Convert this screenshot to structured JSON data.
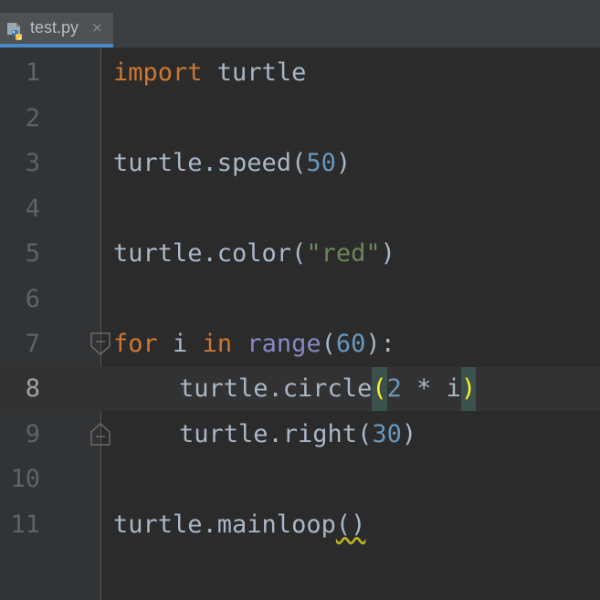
{
  "tab": {
    "filename": "test.py",
    "close_glyph": "×",
    "icon": "python-file-icon"
  },
  "gutter": {
    "line_numbers": [
      "1",
      "2",
      "3",
      "4",
      "5",
      "6",
      "7",
      "8",
      "9",
      "10",
      "11"
    ],
    "current_line": "8"
  },
  "code": {
    "line1": {
      "keyword": "import",
      "module": " turtle"
    },
    "line3": {
      "call": "turtle.speed(",
      "arg": "50",
      "close": ")"
    },
    "line5": {
      "call": "turtle.color(",
      "arg": "\"red\"",
      "close": ")"
    },
    "line7": {
      "kw_for": "for",
      "var": " i ",
      "kw_in": "in",
      "sp": " ",
      "builtin": "range",
      "open": "(",
      "arg": "60",
      "close": "):"
    },
    "line8": {
      "call": "turtle.circle",
      "open": "(",
      "num": "2",
      "rest": " * i",
      "close": ")"
    },
    "line9": {
      "call": "turtle.right(",
      "arg": "30",
      "close": ")"
    },
    "line11": {
      "call": "turtle.mainloop",
      "parens": "()"
    }
  },
  "colors": {
    "background": "#2b2b2b",
    "keyword": "#cc7832",
    "number": "#6897bb",
    "string": "#6a8759",
    "builtin": "#8888c6",
    "text": "#a9b7c6",
    "brace_match": "#ffef28"
  }
}
